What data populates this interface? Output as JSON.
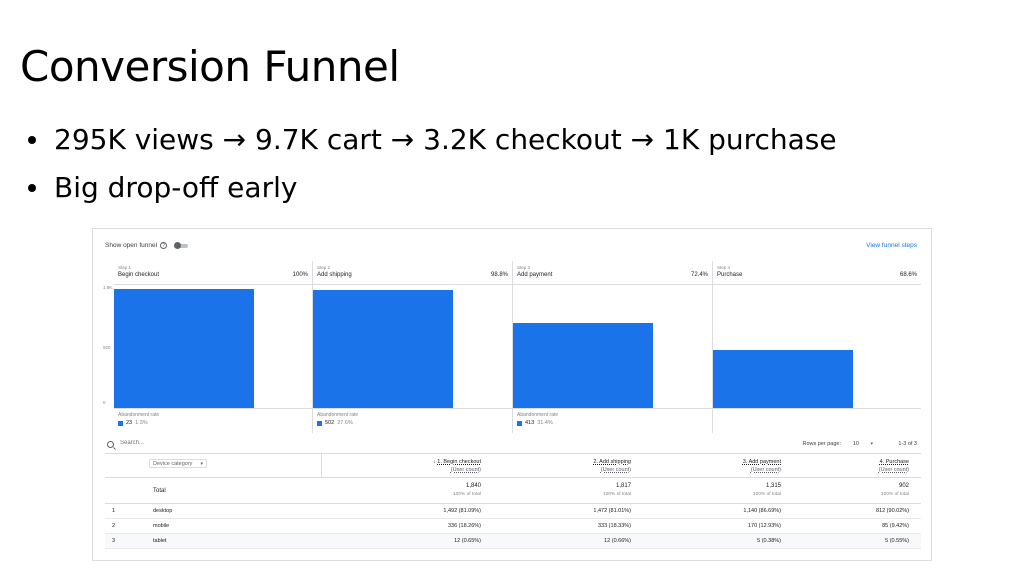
{
  "slide": {
    "title": "Conversion Funnel",
    "bullets": [
      "295K views → 9.7K cart → 3.2K checkout → 1K purchase",
      "Big drop-off early"
    ]
  },
  "panel": {
    "open_funnel_label": "Show open funnel",
    "help_icon_glyph": "?",
    "open_funnel_enabled": false,
    "view_steps_link": "View funnel steps",
    "y_ticks": [
      "1.9K",
      "920",
      "0"
    ],
    "abandonment_label": "Abandonment rate",
    "bar_color": "#1a73e8"
  },
  "chart_data": {
    "type": "bar",
    "categories": [
      "Begin checkout",
      "Add shipping",
      "Add payment",
      "Purchase"
    ],
    "step_labels": [
      "Step 1",
      "Step 2",
      "Step 3",
      "Step 4"
    ],
    "completion_rates": [
      "100%",
      "98.8%",
      "72.4%",
      "68.6%"
    ],
    "values": [
      1840,
      1817,
      1315,
      902
    ],
    "ylim": [
      0,
      1900
    ],
    "abandonment": [
      {
        "count": "23",
        "rate": "1.3%"
      },
      {
        "count": "502",
        "rate": "27.6%"
      },
      {
        "count": "413",
        "rate": "31.4%"
      }
    ]
  },
  "table": {
    "search_placeholder": "Search...",
    "rows_per_page_label": "Rows per page:",
    "rows_per_page_value": "10",
    "caret_glyph": "▾",
    "page_info": "1-3 of 3",
    "dimension_select": "Device category",
    "sort_arrow": "↓",
    "columns": [
      {
        "title": "1. Begin checkout",
        "sub": "(User count)"
      },
      {
        "title": "2. Add shipping",
        "sub": "(User count)"
      },
      {
        "title": "3. Add payment",
        "sub": "(User count)"
      },
      {
        "title": "4. Purchase",
        "sub": "(User count)"
      }
    ],
    "total": {
      "label": "Total",
      "values": [
        "1,840",
        "1,817",
        "1,315",
        "902"
      ],
      "pcts": [
        "100% of total",
        "100% of total",
        "100% of total",
        "100% of total"
      ]
    },
    "rows": [
      {
        "idx": "1",
        "name": "desktop",
        "cells": [
          "1,492 (81.09%)",
          "1,472 (81.01%)",
          "1,140 (86.69%)",
          "812 (90.02%)"
        ]
      },
      {
        "idx": "2",
        "name": "mobile",
        "cells": [
          "336 (18.26%)",
          "333 (18.33%)",
          "170 (12.93%)",
          "85 (9.42%)"
        ]
      },
      {
        "idx": "3",
        "name": "tablet",
        "cells": [
          "12 (0.65%)",
          "12 (0.66%)",
          "5 (0.38%)",
          "5 (0.55%)"
        ]
      }
    ]
  }
}
